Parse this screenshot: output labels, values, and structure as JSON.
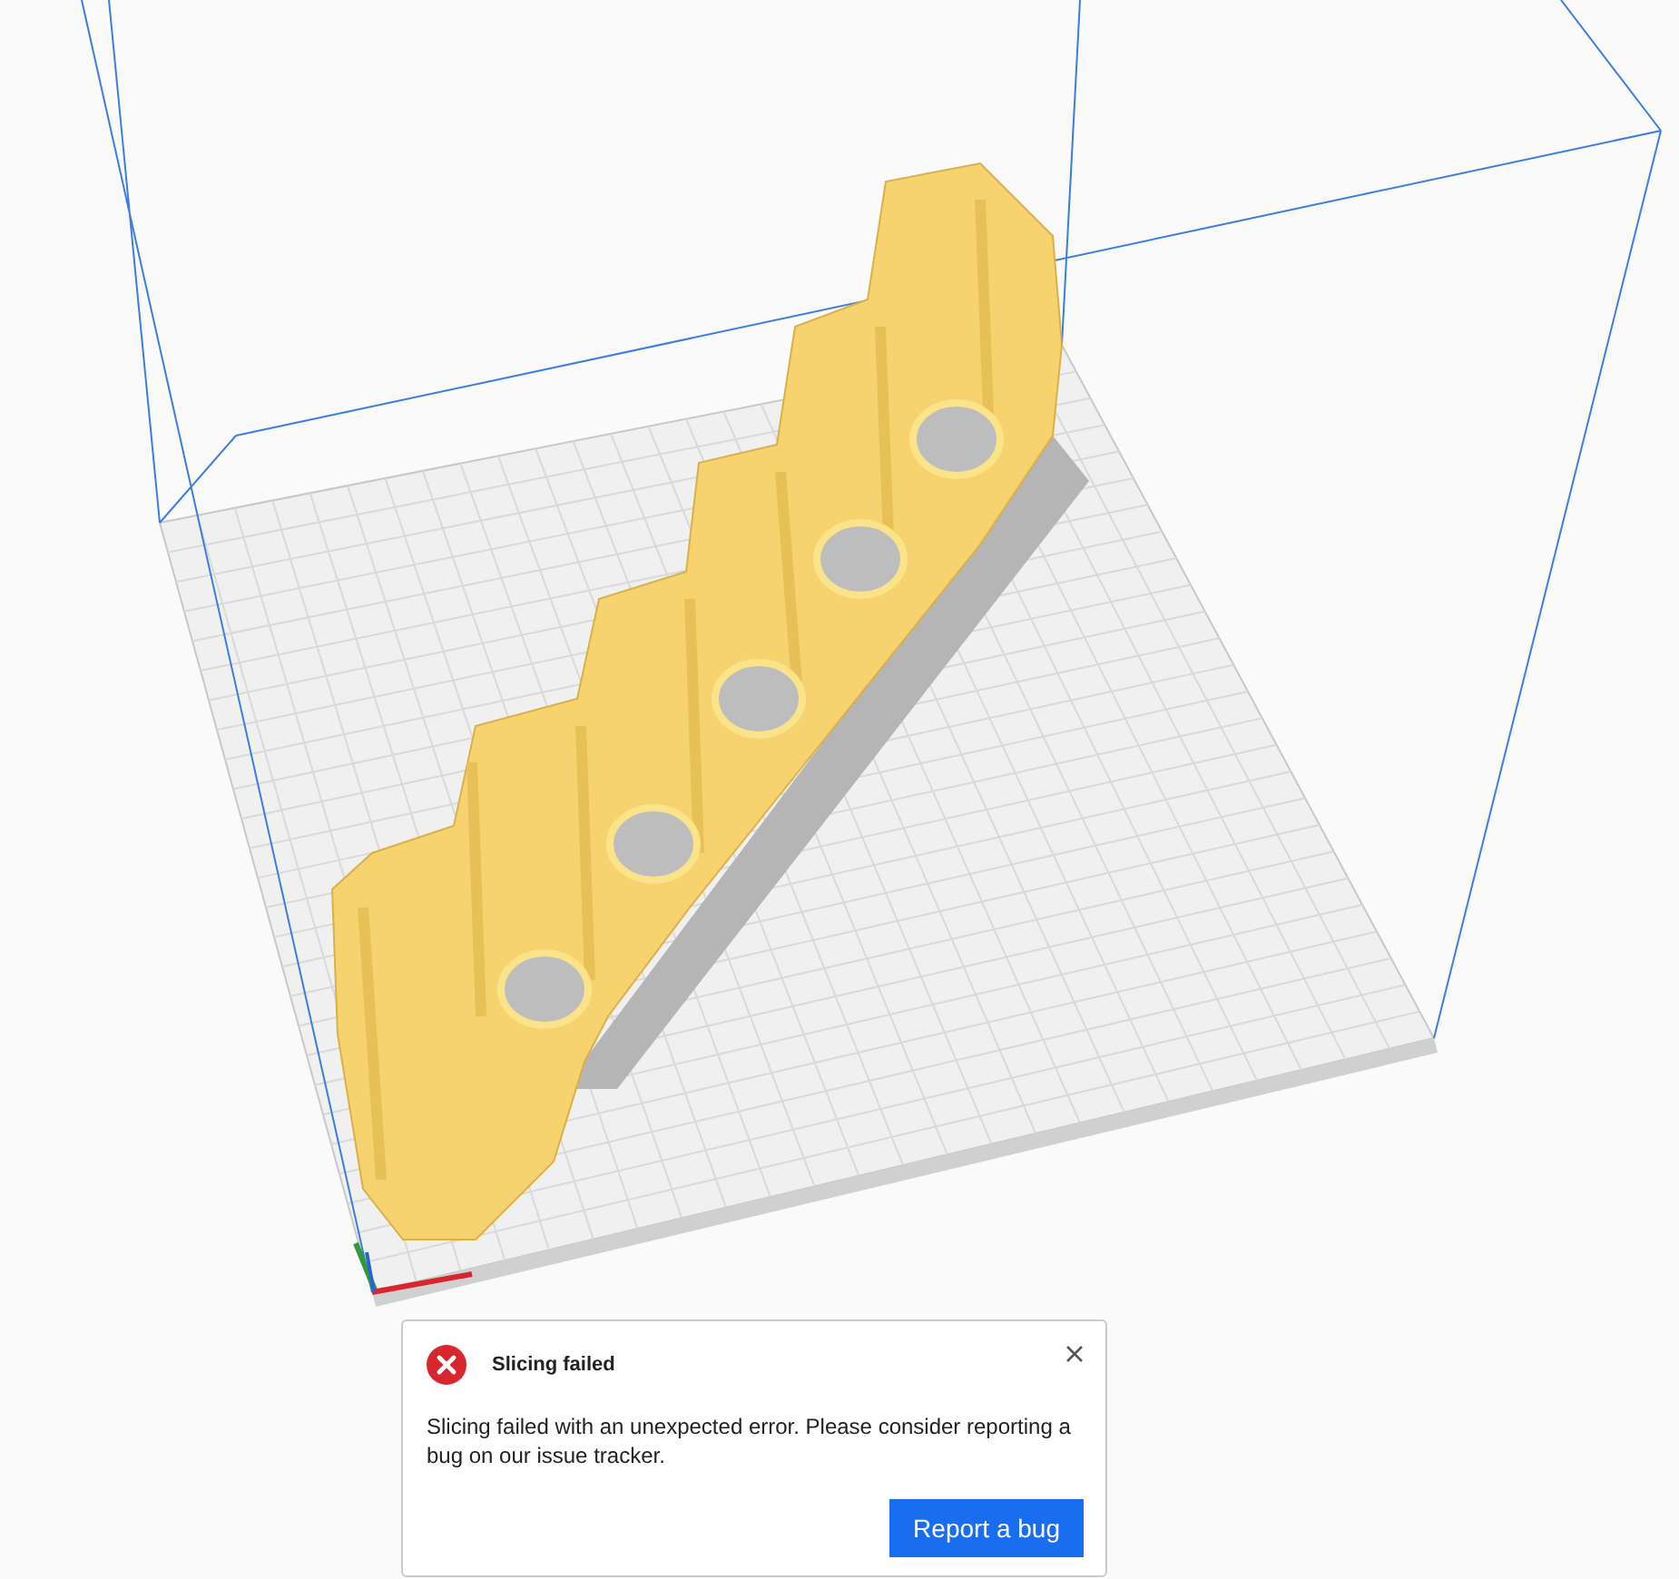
{
  "notification": {
    "title": "Slicing failed",
    "message": "Slicing failed with an unexpected error. Please consider reporting a bug on our issue tracker.",
    "action": "Report a bug"
  }
}
